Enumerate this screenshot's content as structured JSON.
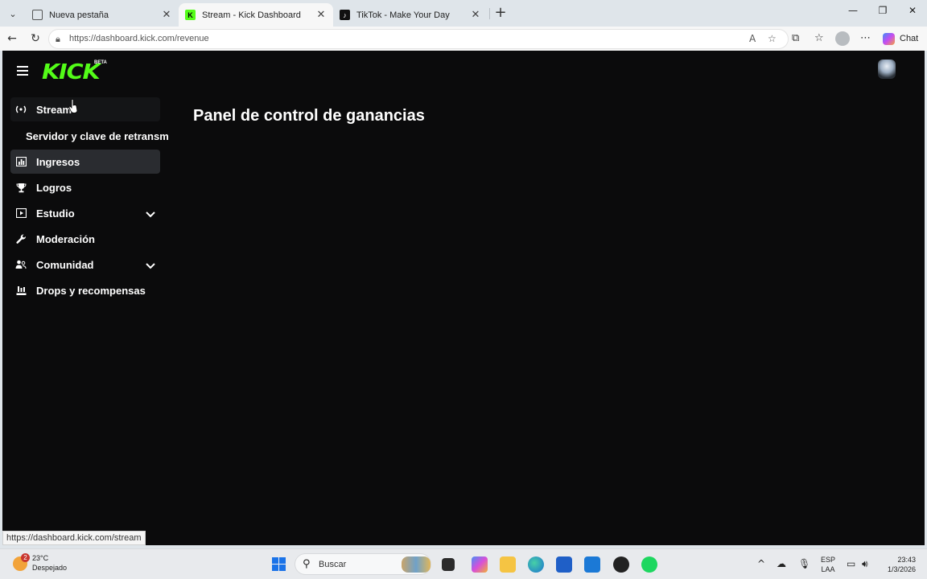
{
  "browser": {
    "tabs": [
      {
        "title": "Nueva pestaña",
        "active": false
      },
      {
        "title": "Stream - Kick Dashboard",
        "active": true
      },
      {
        "title": "TikTok - Make Your Day",
        "active": false
      }
    ],
    "url": "https://dashboard.kick.com/revenue",
    "chat_label": "Chat",
    "status_url": "https://dashboard.kick.com/stream"
  },
  "header": {
    "logo_text": "KICK",
    "logo_badge": "BETA"
  },
  "sidebar": {
    "items": [
      {
        "label": "Stream",
        "icon": "broadcast-icon"
      },
      {
        "label": "Servidor y clave de retransm",
        "icon": ""
      },
      {
        "label": "Ingresos",
        "icon": "chart-icon"
      },
      {
        "label": "Logros",
        "icon": "trophy-icon"
      },
      {
        "label": "Estudio",
        "icon": "studio-icon"
      },
      {
        "label": "Moderación",
        "icon": "wrench-icon"
      },
      {
        "label": "Comunidad",
        "icon": "community-icon"
      },
      {
        "label": "Drops y recompensas",
        "icon": "drops-icon"
      }
    ]
  },
  "main": {
    "title": "Panel de control de ganancias"
  },
  "taskbar": {
    "weather_temp": "23°C",
    "weather_desc": "Despejado",
    "weather_badge": "2",
    "search_placeholder": "Buscar",
    "lang_top": "ESP",
    "lang_bottom": "LAA",
    "time": "23:43",
    "date": "1/3/2026"
  },
  "colors": {
    "kick_green": "#53fc18",
    "page_bg": "#0b0b0c",
    "selected_item_bg": "#2a2c30"
  }
}
